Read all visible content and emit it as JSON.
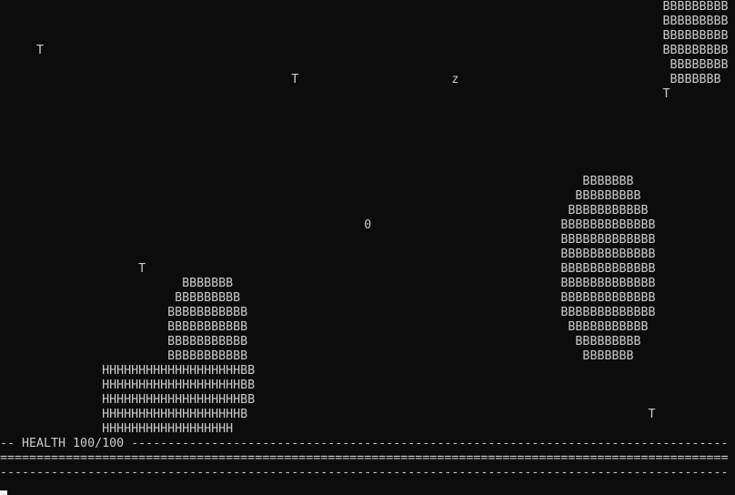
{
  "screen": {
    "rows": [
      "                                                                                           BBBBBBBBB",
      "                                                                                           BBBBBBBBB",
      "                                                                                           BBBBBBBBB",
      "     T                                                                                     BBBBBBBBB",
      "                                                                                            BBBBBBBB",
      "                                        T                     z                             BBBBBBB",
      "                                                                                           T",
      "",
      "",
      "",
      "",
      "",
      "                                                                                BBBBBBB",
      "                                                                               BBBBBBBBB",
      "                                                                              BBBBBBBBBBB",
      "                                                  0                          BBBBBBBBBBBBB",
      "                                                                             BBBBBBBBBBBBB",
      "                                                                             BBBBBBBBBBBBB",
      "                   T                                                         BBBBBBBBBBBBB",
      "                         BBBBBBB                                             BBBBBBBBBBBBB",
      "                        BBBBBBBBB                                            BBBBBBBBBBBBB",
      "                       BBBBBBBBBBB                                           BBBBBBBBBBBBB",
      "                       BBBBBBBBBBB                                            BBBBBBBBBBB",
      "                       BBBBBBBBBBB                                             BBBBBBBBB",
      "                       BBBBBBBBBBB                                              BBBBBBB",
      "              HHHHHHHHHHHHHHHHHHHBB",
      "              HHHHHHHHHHHHHHHHHHHBB",
      "              HHHHHHHHHHHHHHHHHHHBB",
      "              HHHHHHHHHHHHHHHHHHHB                                                       T",
      "              HHHHHHHHHHHHHHHHHH",
      "-- HEALTH 100/100 ----------------------------------------------------------------------------------",
      "====================================================================================================",
      "----------------------------------------------------------------------------------------------------"
    ]
  }
}
